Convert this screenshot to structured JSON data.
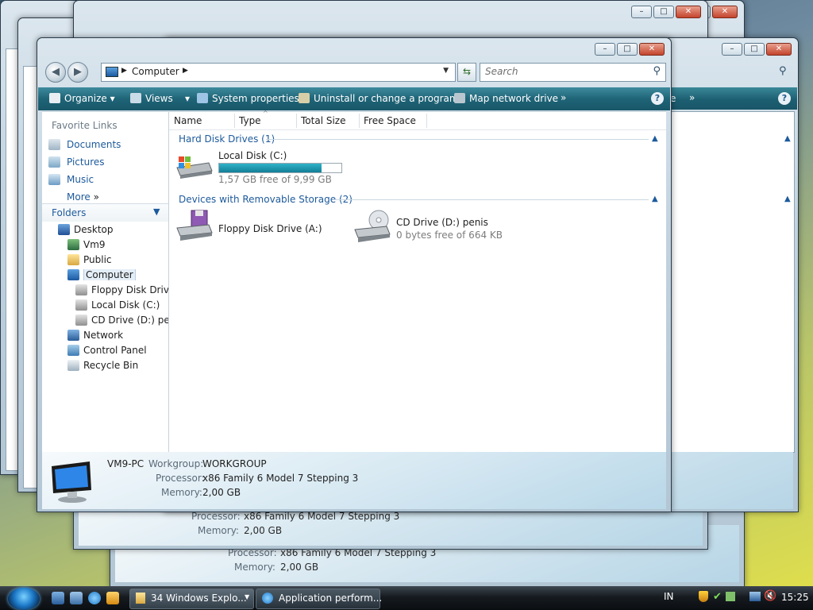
{
  "window": {
    "address": "Computer",
    "search_placeholder": "Search",
    "controls": {
      "minimize": "–",
      "maximize": "□",
      "close": "✕"
    }
  },
  "toolbar": {
    "organize": "Organize",
    "views": "Views",
    "system_properties": "System properties",
    "uninstall": "Uninstall or change a program",
    "map_drive": "Map network drive",
    "more": "»",
    "help": "?"
  },
  "navpane": {
    "favorite_links_title": "Favorite Links",
    "favorites": [
      "Documents",
      "Pictures",
      "Music"
    ],
    "more": "More",
    "folders_label": "Folders",
    "tree": [
      "Desktop",
      "Vm9",
      "Public",
      "Computer",
      "Floppy Disk Drive",
      "Local Disk (C:)",
      "CD Drive (D:) penis",
      "Network",
      "Control Panel",
      "Recycle Bin"
    ]
  },
  "columns": [
    "Name",
    "Type",
    "Total Size",
    "Free Space"
  ],
  "groups": {
    "hard_disk": "Hard Disk Drives (1)",
    "removable": "Devices with Removable Storage (2)"
  },
  "drives": {
    "local": {
      "name": "Local Disk (C:)",
      "free": "1,57 GB free of 9,99 GB",
      "used_fraction": 0.84
    },
    "floppy": {
      "name": "Floppy Disk Drive (A:)"
    },
    "cd": {
      "name": "CD Drive (D:) penis",
      "free": "0 bytes free of 664 KB"
    }
  },
  "details": {
    "computer_name": "VM9-PC",
    "workgroup_label": "Workgroup:",
    "workgroup": "WORKGROUP",
    "processor_label": "Processor:",
    "processor": "x86 Family 6 Model 7 Stepping 3",
    "memory_label": "Memory:",
    "memory": "2,00 GB"
  },
  "background_windows": {
    "toolbar_text": "e",
    "processor_label": "Processor:",
    "processor": "x86 Family 6 Model 7 Stepping 3",
    "memory_label": "Memory:",
    "memory": "2,00 GB"
  },
  "taskbar": {
    "explorer_group": "34 Windows Explo...",
    "app_perf": "Application perform...",
    "language": "IN",
    "clock": "15:25"
  },
  "colors": {
    "accent": "#1d5a9c",
    "command_bar": "#1f6477",
    "capacity_fill": "#1a9ab3"
  }
}
